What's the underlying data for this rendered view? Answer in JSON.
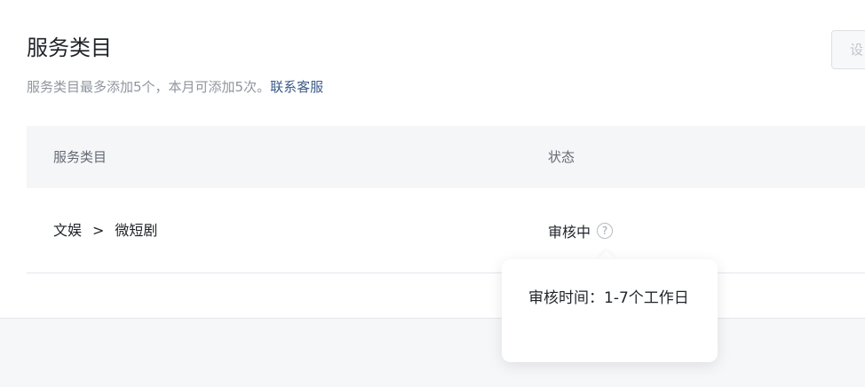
{
  "header": {
    "title": "服务类目",
    "subtitle_text": "服务类目最多添加5个，本月可添加5次。",
    "contact_link": "联系客服",
    "set_button_label": "设"
  },
  "table": {
    "columns": [
      "服务类目",
      "状态"
    ],
    "rows": [
      {
        "category_parent": "文娱",
        "separator": ">",
        "category_child": "微短剧",
        "status": "审核中"
      }
    ]
  },
  "help_icon_glyph": "?",
  "tooltip": {
    "text": "审核时间：1-7个工作日"
  }
}
